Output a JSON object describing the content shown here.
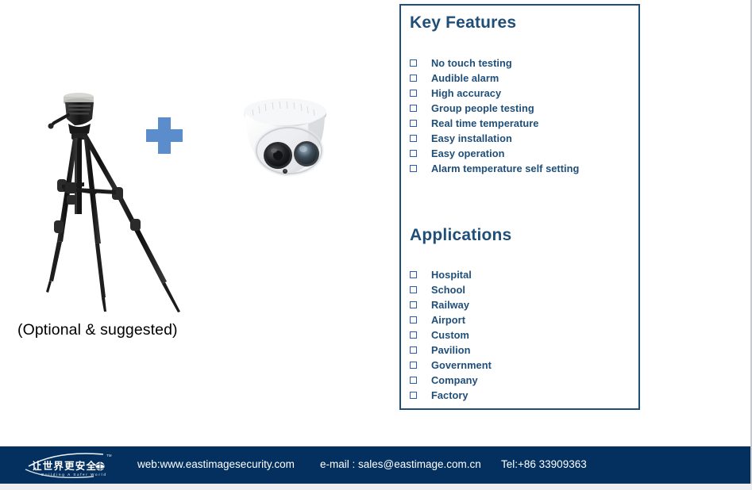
{
  "slide": {
    "caption": "(Optional & suggested)",
    "plus_icon": "plus-icon",
    "accent_blue": "#5b8dcc",
    "box_border_color": "#1f4e79",
    "heading_color": "#1f4e79",
    "footer_bg": "#04305f"
  },
  "info_box": {
    "key_features": {
      "title": "Key Features",
      "items": [
        "No touch testing",
        "Audible alarm",
        "High accuracy",
        "Group people testing",
        "Real time temperature",
        "Easy installation",
        "Easy operation",
        "Alarm temperature self setting"
      ]
    },
    "applications": {
      "title": "Applications",
      "items": [
        "Hospital",
        "School",
        "Railway",
        "Airport",
        "Custom",
        "Pavilion",
        "Government",
        "Company",
        "Factory"
      ]
    }
  },
  "footer": {
    "logo_text_cn": "让世界更安全",
    "logo_tagline": "Building A Safer World",
    "logo_tm": "TM",
    "web": "web:www.eastimagesecurity.com",
    "email": "e-mail : sales@eastimage.com.cn",
    "tel": "Tel:+86 33909363"
  }
}
